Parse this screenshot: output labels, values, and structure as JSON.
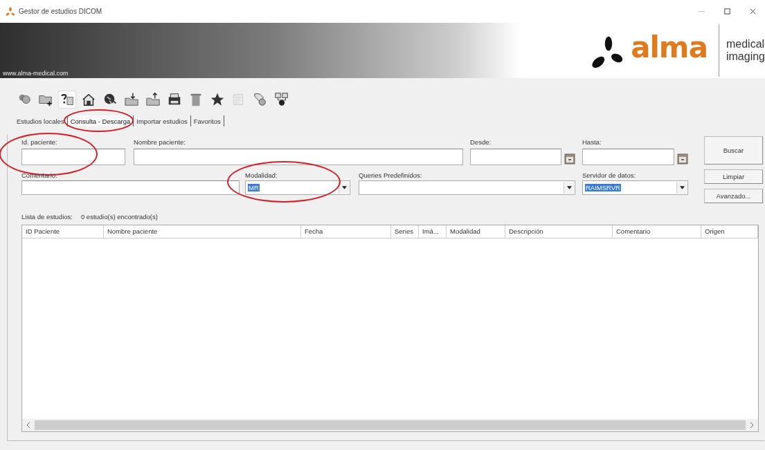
{
  "window": {
    "title": "Gestor de estudios DICOM"
  },
  "banner": {
    "url": "www.alma-medical.com",
    "logo_word": "alma",
    "tagline": [
      "medical",
      "imaging"
    ]
  },
  "toolbar": [
    {
      "kind": "people",
      "pressed": false,
      "disabled": false
    },
    {
      "kind": "folder-add",
      "pressed": false,
      "disabled": false
    },
    {
      "kind": "help",
      "pressed": true,
      "disabled": false
    },
    {
      "kind": "house",
      "pressed": false,
      "disabled": false
    },
    {
      "kind": "globe",
      "pressed": false,
      "disabled": false
    },
    {
      "kind": "folder-down",
      "pressed": false,
      "disabled": false
    },
    {
      "kind": "folder-up",
      "pressed": false,
      "disabled": false
    },
    {
      "kind": "printer",
      "pressed": false,
      "disabled": false
    },
    {
      "kind": "trash",
      "pressed": false,
      "disabled": false
    },
    {
      "kind": "star",
      "pressed": false,
      "disabled": false
    },
    {
      "kind": "document",
      "pressed": false,
      "disabled": true
    },
    {
      "kind": "tag",
      "pressed": false,
      "disabled": false
    },
    {
      "kind": "network",
      "pressed": false,
      "disabled": false
    }
  ],
  "tabs": [
    {
      "label": "Estudios locales",
      "selected": false,
      "highlighted": false
    },
    {
      "label": "Consulta - Descarga",
      "selected": true,
      "highlighted": true
    },
    {
      "label": "Importar estudios",
      "selected": false,
      "highlighted": false
    },
    {
      "label": "Favoritos",
      "selected": false,
      "highlighted": false
    }
  ],
  "fields": [
    {
      "kind": "text",
      "label": "Id. paciente:",
      "highlighted": true
    },
    {
      "kind": "text",
      "label": "Nombre paciente:",
      "highlighted": false
    },
    {
      "kind": "date",
      "label": "Desde:",
      "highlighted": false
    },
    {
      "kind": "date",
      "label": "Hasta:",
      "highlighted": false
    },
    {
      "kind": "text",
      "label": "Comentario:",
      "highlighted": false
    },
    {
      "kind": "combo",
      "label": "Modalidad:",
      "value": "MR",
      "highlighted": true
    },
    {
      "kind": "combo",
      "label": "Queries Predefinidos:",
      "highlighted": false
    },
    {
      "kind": "combo",
      "label": "Servidor de datos:",
      "value": "RAIMSRVR",
      "highlighted": false
    }
  ],
  "buttons": [
    "Buscar",
    "Limpiar",
    "Avanzado..."
  ],
  "list": {
    "label": "Lista de estudios:",
    "count": "0 estudio(s) encontrado(s)"
  },
  "table": {
    "columns": [
      "ID Paciente",
      "Nombre paciente",
      "Fecha",
      "Series",
      "Imá...",
      "Modalidad",
      "Descripción",
      "Comentario",
      "Origen"
    ]
  }
}
